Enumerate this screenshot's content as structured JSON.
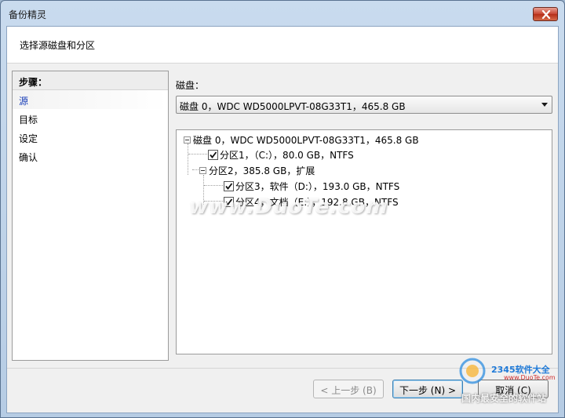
{
  "window": {
    "title": "备份精灵"
  },
  "header": {
    "text": "选择源磁盘和分区"
  },
  "steps": {
    "title": "步骤：",
    "items": [
      {
        "label": "源",
        "active": true
      },
      {
        "label": "目标",
        "active": false
      },
      {
        "label": "设定",
        "active": false
      },
      {
        "label": "确认",
        "active": false
      }
    ]
  },
  "disk": {
    "label": "磁盘：",
    "selected": "磁盘 0，WDC WD5000LPVT-08G33T1，465.8 GB"
  },
  "tree": {
    "root": "磁盘 0，WDC WD5000LPVT-08G33T1，465.8 GB",
    "p1": "分区1，（C:），80.0 GB，NTFS",
    "p2": "分区2，385.8 GB，扩展",
    "p3": "分区3，软件（D:），193.0 GB，NTFS",
    "p4": "分区4，文档（E:），192.8 GB，NTFS"
  },
  "watermark": "www.DuoTe.com",
  "buttons": {
    "back": "< 上一步 (B)",
    "next": "下一步 (N) >",
    "cancel": "取消 (C)"
  },
  "corner_logo": {
    "brand": "2345软件大全",
    "url": "www.DuoTe.com",
    "slogan": "国内最安全的软件站"
  }
}
